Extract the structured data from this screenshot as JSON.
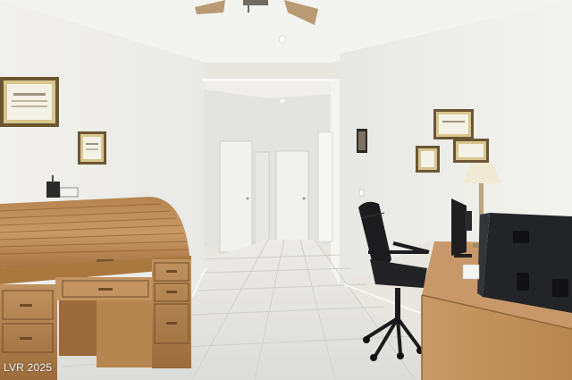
{
  "photo": {
    "watermark": "LVR 2025",
    "colors": {
      "wall": "#eeeeeb",
      "ceiling": "#f2f2ef",
      "floor_tile": "#e6e6e3",
      "wood": "#b58857",
      "wood_dark": "#8a5f33",
      "chair": "#1b1b1d",
      "speaker": "#222326"
    }
  }
}
